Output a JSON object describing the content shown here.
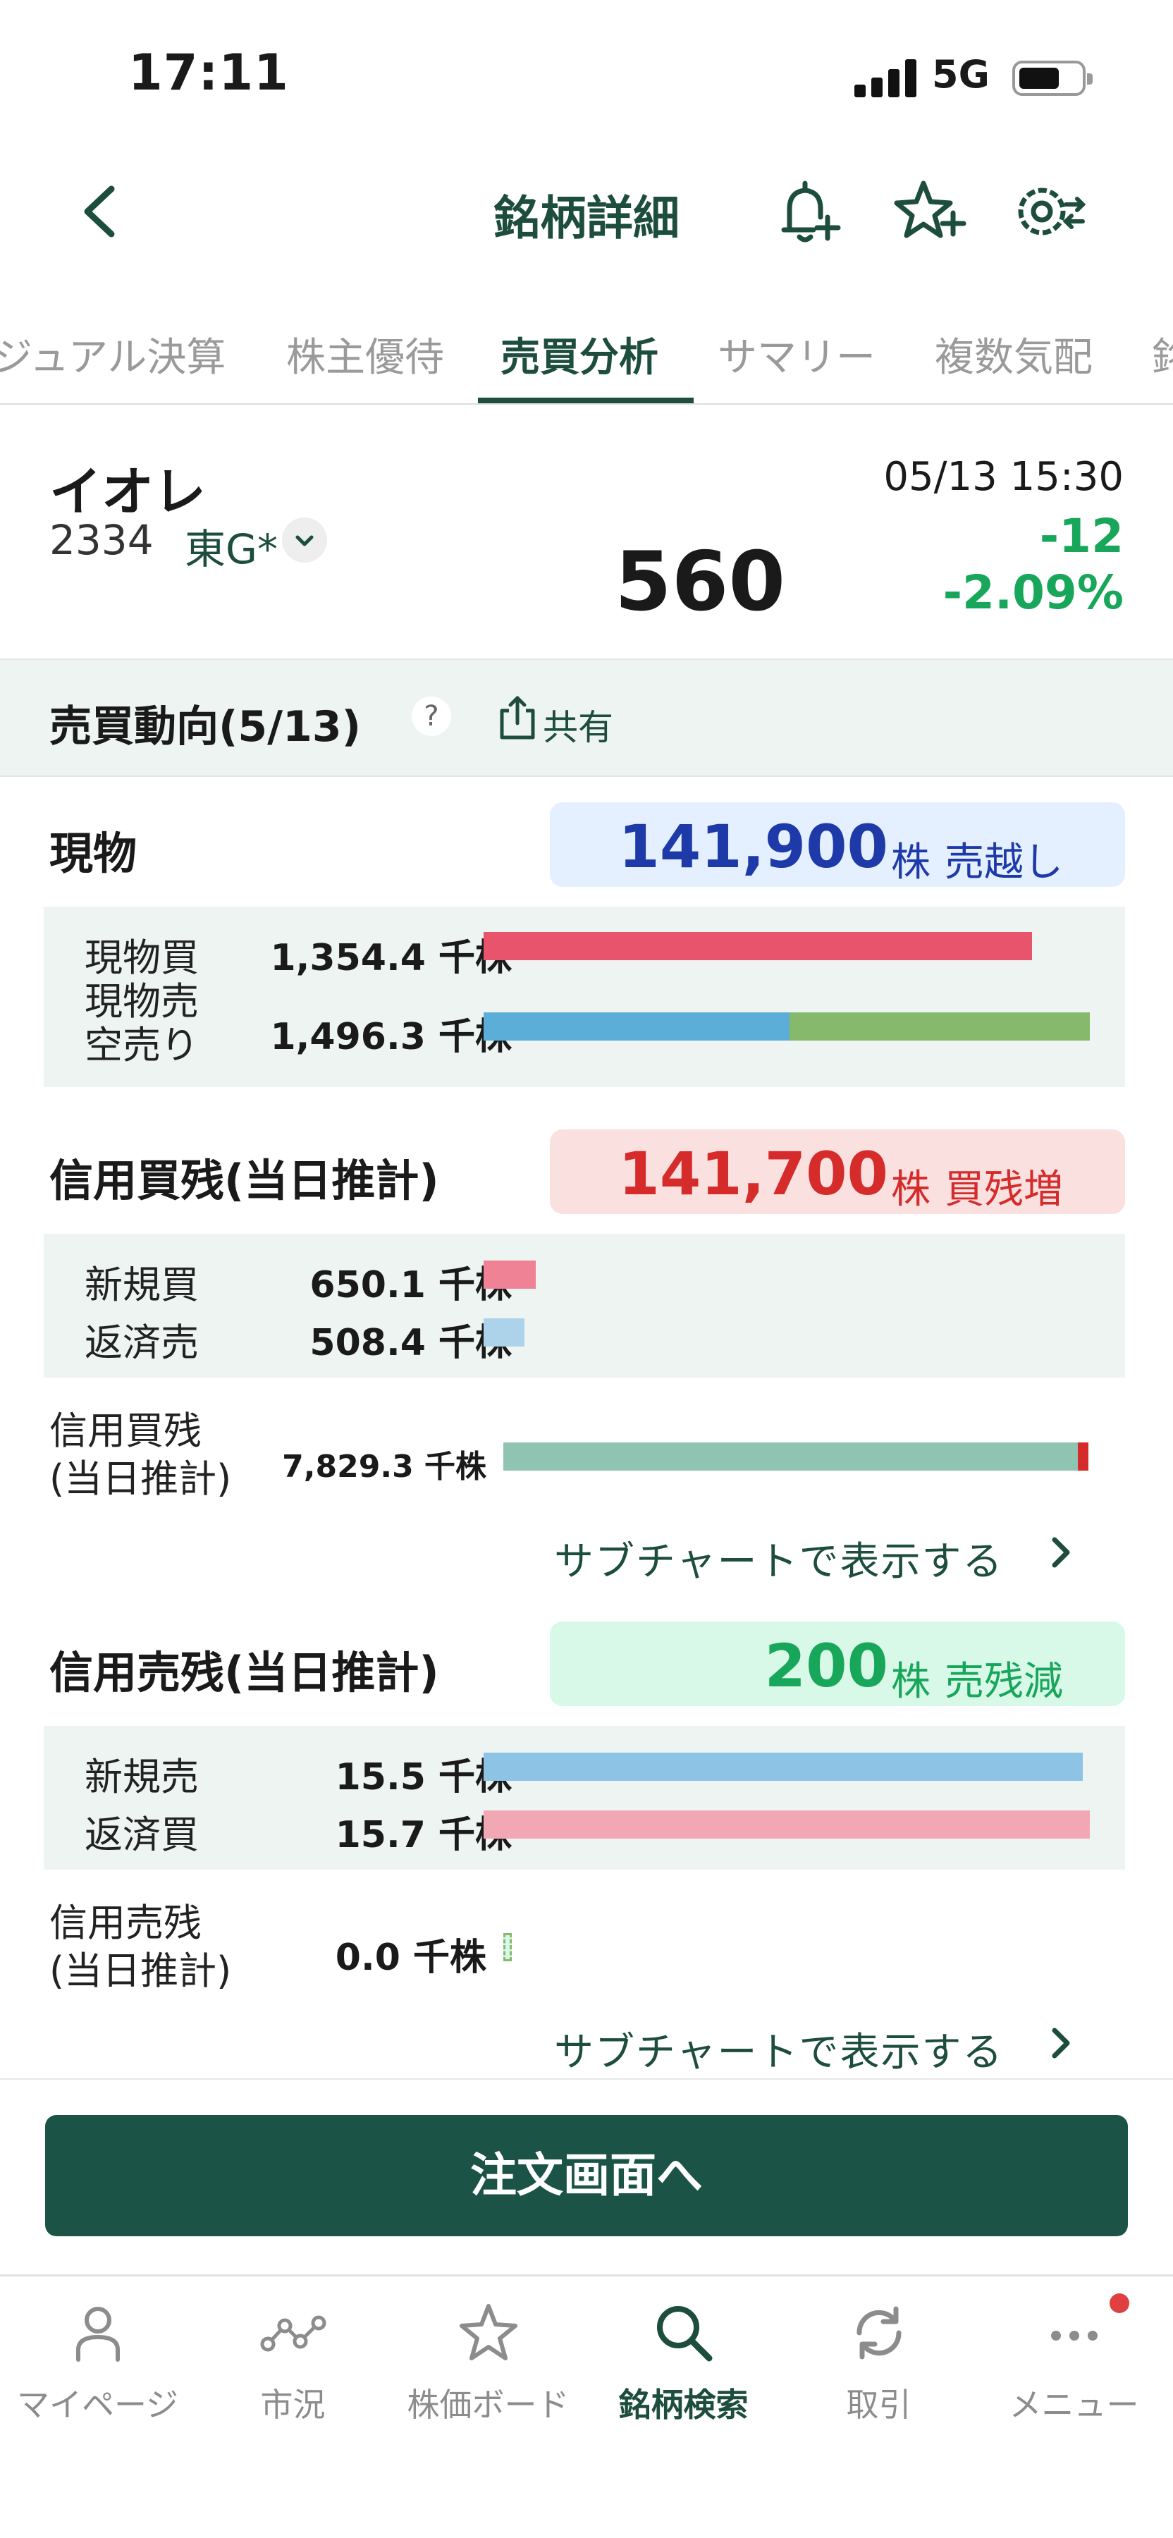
{
  "status": {
    "time": "17:11",
    "network": "5G"
  },
  "header": {
    "title": "銘柄詳細"
  },
  "tabs": [
    {
      "label": "ジュアル決算"
    },
    {
      "label": "株主優待"
    },
    {
      "label": "売買分析",
      "active": true
    },
    {
      "label": "サマリー"
    },
    {
      "label": "複数気配"
    },
    {
      "label": "銘"
    }
  ],
  "stock": {
    "name": "イオレ",
    "code": "2334",
    "market": "東G*",
    "price": "560",
    "datetime": "05/13 15:30",
    "change": "-12",
    "change_pct": "-2.09%"
  },
  "trend": {
    "title": "売買動向(5/13)",
    "help": "?",
    "share_label": "共有"
  },
  "spot": {
    "title": "現物",
    "badge_value": "141,900",
    "badge_unit": "株",
    "badge_status": "売越し",
    "buy_label": "現物買",
    "buy_value": "1,354.4 千株",
    "sell_label_1": "現物売",
    "sell_label_2": "空売り",
    "sell_value": "1,496.3 千株",
    "buy_fill": 0.905,
    "sell_spot_fill": 0.505,
    "sell_short_fill": 0.495
  },
  "margin_buy": {
    "title": "信用買残(当日推計)",
    "badge_value": "141,700",
    "badge_unit": "株",
    "badge_status": "買残増",
    "new_label": "新規買",
    "new_value": "650.1 千株",
    "repay_label": "返済売",
    "repay_value": "508.4 千株",
    "new_fill": 0.086,
    "repay_fill": 0.067,
    "balance_label_1": "信用買残",
    "balance_label_2": "(当日推計)",
    "balance_value": "7,829.3 千株",
    "balance_fill": 0.982,
    "balance_delta_fill": 0.018,
    "subchart_label": "サブチャートで表示する"
  },
  "margin_sell": {
    "title": "信用売残(当日推計)",
    "badge_value": "200",
    "badge_unit": "株",
    "badge_status": "売残減",
    "new_label": "新規売",
    "new_value": "15.5 千株",
    "repay_label": "返済買",
    "repay_value": "15.7 千株",
    "new_fill": 0.988,
    "repay_fill": 1.0,
    "balance_label_1": "信用売残",
    "balance_label_2": "(当日推計)",
    "balance_value": "0.0 千株",
    "subchart_label": "サブチャートで表示する"
  },
  "order_button": "注文画面へ",
  "nav": [
    {
      "label": "マイページ",
      "icon": "person-icon"
    },
    {
      "label": "市況",
      "icon": "market-icon"
    },
    {
      "label": "株価ボード",
      "icon": "star-icon"
    },
    {
      "label": "銘柄検索",
      "icon": "search-icon",
      "active": true
    },
    {
      "label": "取引",
      "icon": "refresh-icon"
    },
    {
      "label": "メニュー",
      "icon": "more-icon"
    }
  ],
  "colors": {
    "brand": "#1d4d3d",
    "up": "#d52b2b",
    "down": "#18a65a",
    "bar_buy": "#e8546c",
    "bar_sell": "#5aaed8",
    "bar_short": "#86b96c",
    "bar_balance": "#8fc3b2"
  }
}
